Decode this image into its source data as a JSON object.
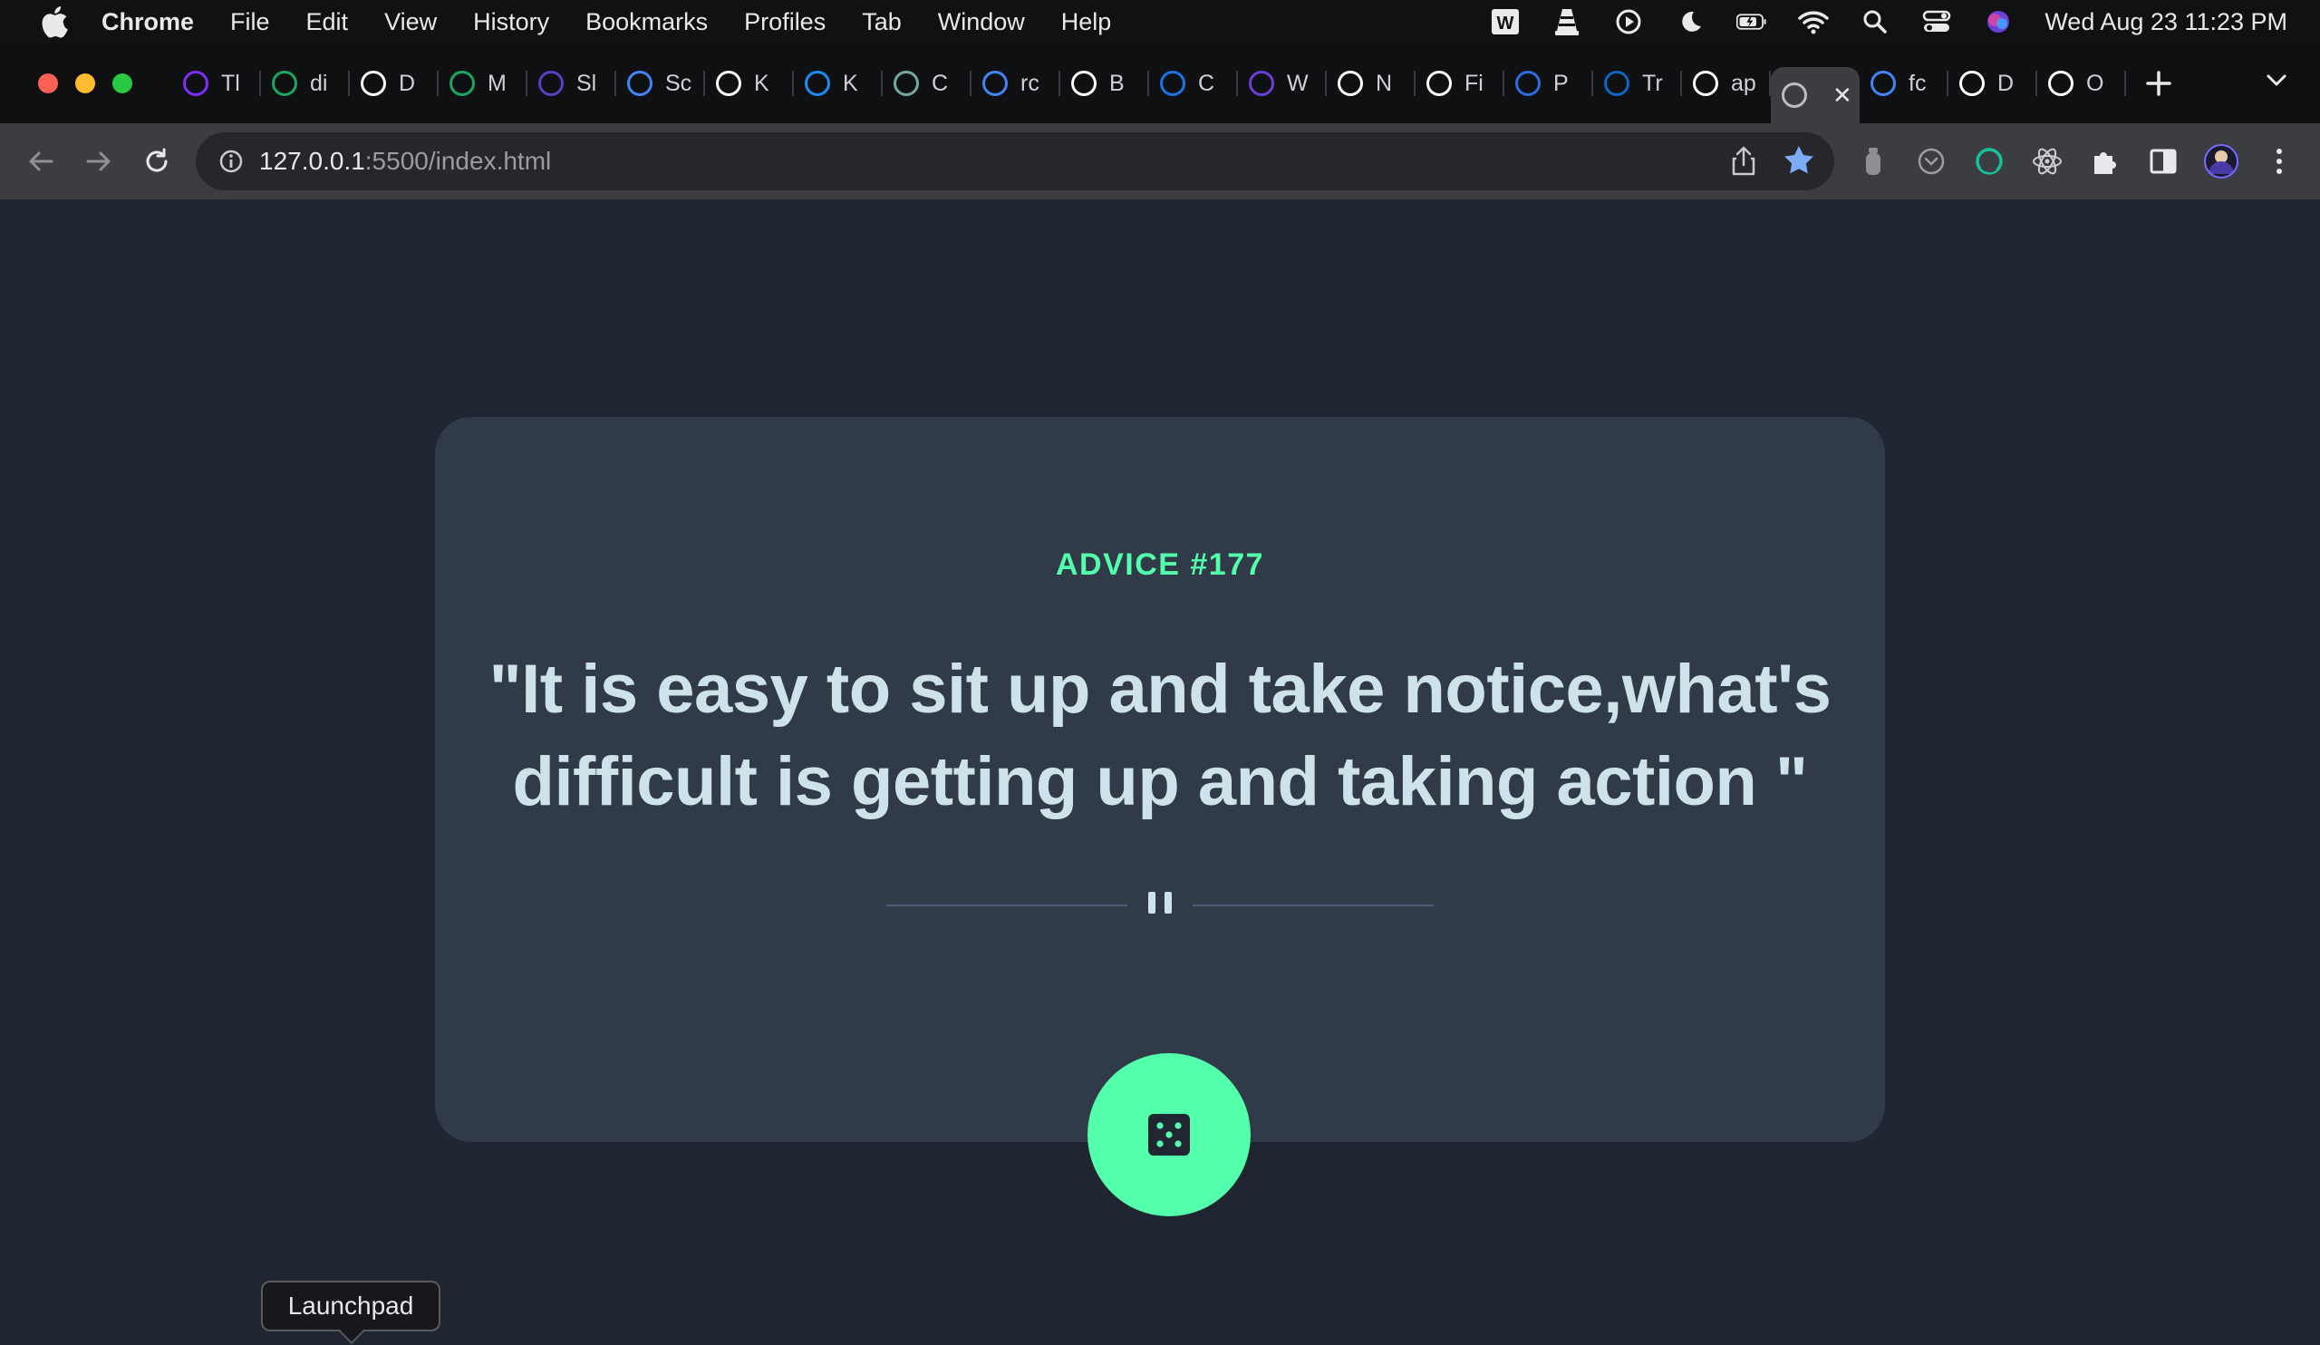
{
  "menubar": {
    "app_name": "Chrome",
    "items": [
      "File",
      "Edit",
      "View",
      "History",
      "Bookmarks",
      "Profiles",
      "Tab",
      "Window",
      "Help"
    ],
    "status_icons": [
      "word-icon",
      "vlc-icon",
      "play-icon",
      "moon-icon",
      "battery-icon",
      "wifi-icon",
      "spotlight-icon",
      "control-center-icon",
      "siri-icon"
    ],
    "clock": "Wed Aug 23  11:23 PM"
  },
  "tabs": [
    {
      "icon": "tab-icon-purple-u",
      "label": "Tl",
      "color": "#7b2ff7"
    },
    {
      "icon": "google-drive-icon",
      "label": "di",
      "color": "#1fa463"
    },
    {
      "icon": "download-icon",
      "label": "D",
      "color": "#ffffff"
    },
    {
      "icon": "google-drive-icon",
      "label": "M",
      "color": "#1fa463"
    },
    {
      "icon": "list-icon",
      "label": "Sl",
      "color": "#5b3cc4"
    },
    {
      "icon": "google-icon",
      "label": "Sc",
      "color": "#4285f4"
    },
    {
      "icon": "k-icon",
      "label": "K",
      "color": "#ffffff"
    },
    {
      "icon": "k-blue-icon",
      "label": "K",
      "color": "#1d8bf1"
    },
    {
      "icon": "chatgpt-icon",
      "label": "C",
      "color": "#74aa9c"
    },
    {
      "icon": "google-icon",
      "label": "rc",
      "color": "#4285f4"
    },
    {
      "icon": "r-icon",
      "label": "B",
      "color": "#ffffff"
    },
    {
      "icon": "c-blue-icon",
      "label": "C",
      "color": "#1a73e8"
    },
    {
      "icon": "mask-icon",
      "label": "W",
      "color": "#6b3fd6"
    },
    {
      "icon": "chrome-icon",
      "label": "N",
      "color": "#ffffff"
    },
    {
      "icon": "page-icon",
      "label": "Fi",
      "color": "#ffffff"
    },
    {
      "icon": "u-blue-icon",
      "label": "P",
      "color": "#2d6cdf"
    },
    {
      "icon": "linkedin-icon",
      "label": "Tr",
      "color": "#0a66c2"
    },
    {
      "icon": "github-icon",
      "label": "ap",
      "color": "#ffffff"
    },
    {
      "icon": "globe-icon",
      "label": "",
      "color": "#bdbdbd",
      "active": true
    },
    {
      "icon": "google-icon",
      "label": "fc",
      "color": "#4285f4"
    },
    {
      "icon": "triangle-icon",
      "label": "D",
      "color": "#ffffff"
    },
    {
      "icon": "github-icon",
      "label": "O",
      "color": "#ffffff"
    }
  ],
  "toolbar": {
    "url_host": "127.0.0.1",
    "url_rest": ":5500/index.html"
  },
  "page": {
    "advice_label": "ADVICE #177",
    "quote": "\"It is easy to sit up and take notice,what's difficult is getting up and taking action \""
  },
  "tooltip": {
    "label": "Launchpad"
  },
  "colors": {
    "accent": "#53ffaa",
    "card": "#313a48",
    "background": "#1f2632",
    "quote_text": "#cee3e9"
  }
}
